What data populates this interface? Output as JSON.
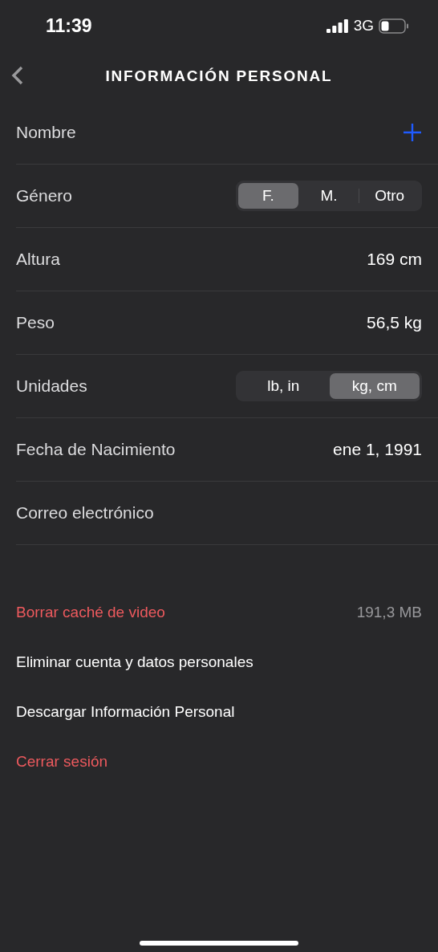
{
  "status_bar": {
    "time": "11:39",
    "network": "3G"
  },
  "nav": {
    "title": "INFORMACIÓN PERSONAL"
  },
  "fields": [
    {
      "kind": "add",
      "label": "Nombre"
    },
    {
      "kind": "segmented",
      "label": "Género",
      "options": [
        {
          "label": "F.",
          "selected": true
        },
        {
          "label": "M.",
          "selected": false
        },
        {
          "label": "Otro",
          "selected": false
        }
      ]
    },
    {
      "kind": "value",
      "label": "Altura",
      "value": "169 cm"
    },
    {
      "kind": "value",
      "label": "Peso",
      "value": "56,5 kg"
    },
    {
      "kind": "segmented",
      "label": "Unidades",
      "options": [
        {
          "label": "lb, in",
          "selected": false
        },
        {
          "label": "kg, cm",
          "selected": true
        }
      ]
    },
    {
      "kind": "value",
      "label": "Fecha de Nacimiento",
      "value": "ene 1, 1991"
    },
    {
      "kind": "empty",
      "label": "Correo electrónico"
    }
  ],
  "actions": [
    {
      "kind": "danger",
      "label": "Borrar caché de video",
      "detail": "191,3 MB"
    },
    {
      "kind": "plain",
      "label": "Eliminar cuenta y datos personales"
    },
    {
      "kind": "plain",
      "label": "Descargar Información Personal"
    },
    {
      "kind": "danger",
      "label": "Cerrar sesión"
    }
  ]
}
